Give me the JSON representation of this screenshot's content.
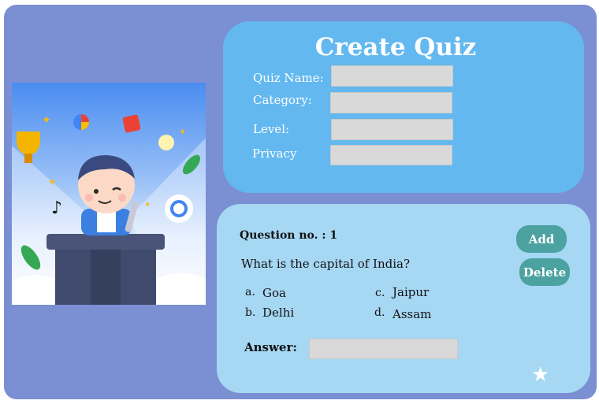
{
  "header": {
    "title": "Create Quiz"
  },
  "form": {
    "quiz_name_label": "Quiz Name:",
    "category_label": "Category:",
    "level_label": "Level:",
    "privacy_label": "Privacy",
    "quiz_name_value": "",
    "category_value": "",
    "level_value": "",
    "privacy_value": ""
  },
  "question": {
    "number_label": "Question no. : 1",
    "text": "What is the capital of India?",
    "options": [
      {
        "letter": "a.",
        "text": "Goa"
      },
      {
        "letter": "b.",
        "text": "Delhi"
      },
      {
        "letter": "c.",
        "text": "Jaipur"
      },
      {
        "letter": "d.",
        "text": "Assam"
      }
    ],
    "answer_label": "Answer:",
    "answer_value": ""
  },
  "buttons": {
    "add_label": "Add",
    "delete_label": "Delete"
  },
  "icons": {
    "star": "star-icon",
    "illustration": "quiz-presenter-illustration"
  },
  "colors": {
    "background": "#7b8fd3",
    "top_card": "#63b8f0",
    "bottom_card": "#a6d7f3",
    "button": "#4ba2a0",
    "input": "#d9d9d9"
  }
}
